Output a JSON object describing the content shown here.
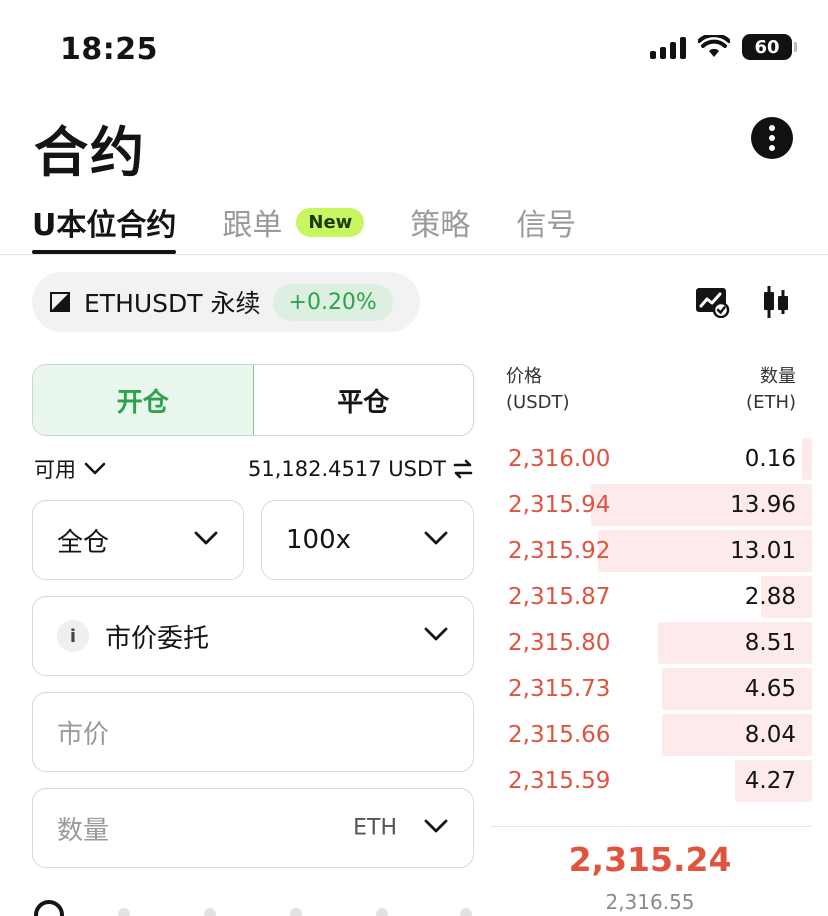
{
  "status_bar": {
    "time": "18:25",
    "battery": "60"
  },
  "header": {
    "title": "合约"
  },
  "tabs": [
    {
      "label": "U本位合约",
      "active": true
    },
    {
      "label": "跟单",
      "badge": "New"
    },
    {
      "label": "策略"
    },
    {
      "label": "信号"
    }
  ],
  "symbol": {
    "name": "ETHUSDT 永续",
    "change": "+0.20%"
  },
  "order_form": {
    "open_label": "开仓",
    "close_label": "平仓",
    "available_label": "可用",
    "available_value": "51,182.4517 USDT",
    "margin_mode": "全仓",
    "leverage": "100x",
    "order_type": "市价委托",
    "price_placeholder": "市价",
    "quantity_placeholder": "数量",
    "quantity_unit": "ETH"
  },
  "order_book": {
    "price_header": "价格",
    "price_unit": "(USDT)",
    "qty_header": "数量",
    "qty_unit": "(ETH)",
    "asks": [
      {
        "price": "2,316.00",
        "qty": "0.16",
        "depth": 0.03
      },
      {
        "price": "2,315.94",
        "qty": "13.96",
        "depth": 0.69
      },
      {
        "price": "2,315.92",
        "qty": "13.01",
        "depth": 0.67
      },
      {
        "price": "2,315.87",
        "qty": "2.88",
        "depth": 0.16
      },
      {
        "price": "2,315.80",
        "qty": "8.51",
        "depth": 0.48
      },
      {
        "price": "2,315.73",
        "qty": "4.65",
        "depth": 0.47
      },
      {
        "price": "2,315.66",
        "qty": "8.04",
        "depth": 0.47
      },
      {
        "price": "2,315.59",
        "qty": "4.27",
        "depth": 0.24
      }
    ],
    "last_price": "2,315.24",
    "mark_price": "2,316.55"
  },
  "colors": {
    "ask": "#e0533f",
    "bid": "#2ea14d",
    "accent_new": "#c8f560"
  }
}
